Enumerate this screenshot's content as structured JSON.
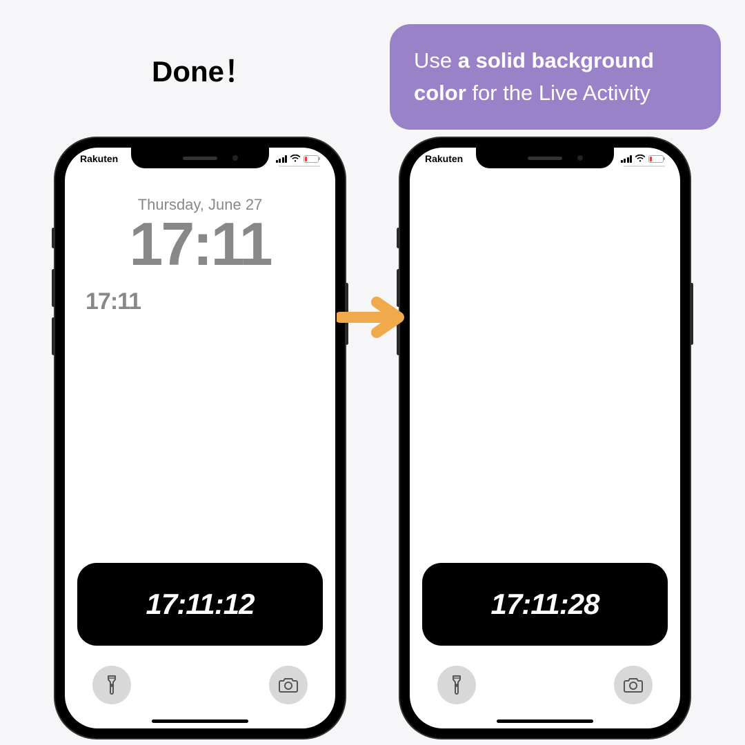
{
  "header": {
    "left_text": "Done！",
    "callout_prefix": "Use ",
    "callout_bold": "a solid background color",
    "callout_suffix": " for the Live Activity"
  },
  "phones": {
    "left": {
      "carrier": "Rakuten",
      "date": "Thursday, June 27",
      "time": "17:11",
      "subtime": "17:11",
      "live_activity_time": "17:11:12"
    },
    "right": {
      "carrier": "Rakuten",
      "live_activity_time": "17:11:28"
    }
  },
  "colors": {
    "callout_bg": "#9982c8",
    "arrow": "#f0a94b",
    "page_bg": "#f6f5f7"
  }
}
